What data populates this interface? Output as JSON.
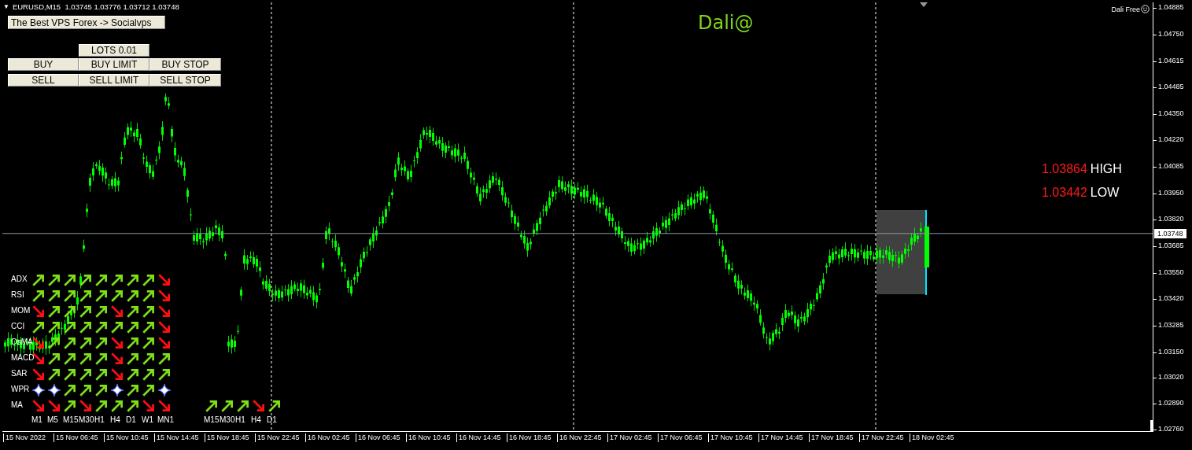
{
  "chart_header": {
    "collapse_glyph": "▼",
    "symbol_line": "EURUSD,M15  1.03745 1.03776 1.03712 1.03748"
  },
  "promo_button": "The Best VPS Forex -> Socialvps",
  "lots_button": "LOTS 0.01",
  "order_buttons": [
    {
      "labels": [
        "BUY",
        "BUY LIMIT",
        "BUY STOP"
      ]
    },
    {
      "labels": [
        "SELL",
        "SELL LIMIT",
        "SELL STOP"
      ]
    }
  ],
  "brand_label": "Dali@",
  "indicator_title": "Dali Free",
  "levels": [
    {
      "value": "1.03864",
      "label": "HIGH"
    },
    {
      "value": "1.03442",
      "label": "LOW"
    }
  ],
  "signal_matrix": {
    "rows": [
      {
        "name": "ADX",
        "signals": [
          {
            "kind": "up"
          },
          {
            "kind": "up"
          },
          {
            "kind": "up"
          },
          {
            "kind": "up"
          },
          {
            "kind": "up"
          },
          {
            "kind": "up"
          },
          {
            "kind": "up"
          },
          {
            "kind": "up"
          },
          {
            "kind": "down"
          }
        ]
      },
      {
        "name": "RSI",
        "signals": [
          {
            "kind": "up"
          },
          {
            "kind": "up"
          },
          {
            "kind": "up"
          },
          {
            "kind": "up"
          },
          {
            "kind": "up"
          },
          {
            "kind": "up"
          },
          {
            "kind": "up"
          },
          {
            "kind": "up"
          },
          {
            "kind": "down"
          }
        ]
      },
      {
        "name": "MOM",
        "signals": [
          {
            "kind": "down"
          },
          {
            "kind": "up"
          },
          {
            "kind": "up"
          },
          {
            "kind": "up"
          },
          {
            "kind": "up"
          },
          {
            "kind": "down"
          },
          {
            "kind": "up"
          },
          {
            "kind": "up"
          },
          {
            "kind": "down"
          }
        ]
      },
      {
        "name": "CCI",
        "signals": [
          {
            "kind": "up"
          },
          {
            "kind": "up"
          },
          {
            "kind": "up"
          },
          {
            "kind": "up"
          },
          {
            "kind": "up"
          },
          {
            "kind": "up"
          },
          {
            "kind": "up"
          },
          {
            "kind": "up"
          },
          {
            "kind": "down"
          }
        ]
      },
      {
        "name": "OsMA",
        "signals": [
          {
            "kind": "down"
          },
          {
            "kind": "up"
          },
          {
            "kind": "up"
          },
          {
            "kind": "up"
          },
          {
            "kind": "up"
          },
          {
            "kind": "down"
          },
          {
            "kind": "up"
          },
          {
            "kind": "up"
          },
          {
            "kind": "down"
          }
        ]
      },
      {
        "name": "MACD",
        "signals": [
          {
            "kind": "down"
          },
          {
            "kind": "up"
          },
          {
            "kind": "up"
          },
          {
            "kind": "up"
          },
          {
            "kind": "up"
          },
          {
            "kind": "down"
          },
          {
            "kind": "up"
          },
          {
            "kind": "up"
          },
          {
            "kind": "up"
          }
        ]
      },
      {
        "name": "SAR",
        "signals": [
          {
            "kind": "down"
          },
          {
            "kind": "up"
          },
          {
            "kind": "up"
          },
          {
            "kind": "up"
          },
          {
            "kind": "up"
          },
          {
            "kind": "down"
          },
          {
            "kind": "up"
          },
          {
            "kind": "up"
          },
          {
            "kind": "up"
          }
        ]
      },
      {
        "name": "WPR",
        "signals": [
          {
            "kind": "neutral"
          },
          {
            "kind": "neutral"
          },
          {
            "kind": "up"
          },
          {
            "kind": "up"
          },
          {
            "kind": "up"
          },
          {
            "kind": "neutral"
          },
          {
            "kind": "up"
          },
          {
            "kind": "up"
          },
          {
            "kind": "neutral"
          }
        ]
      },
      {
        "name": "MA",
        "signals": [
          {
            "kind": "down"
          },
          {
            "kind": "down"
          },
          {
            "kind": "up"
          },
          {
            "kind": "down"
          },
          {
            "kind": "up"
          },
          {
            "kind": "up"
          },
          {
            "kind": "up"
          },
          {
            "kind": "down"
          },
          {
            "kind": "down"
          }
        ]
      }
    ],
    "timeframes": [
      "M1",
      "M5",
      "M15",
      "M30",
      "H1",
      "H4",
      "D1",
      "W1",
      "MN1"
    ]
  },
  "second_matrix": {
    "signals": [
      {
        "kind": "up"
      },
      {
        "kind": "up"
      },
      {
        "kind": "up"
      },
      {
        "kind": "down"
      },
      {
        "kind": "up"
      }
    ],
    "timeframes": [
      "M15",
      "M30",
      "H1",
      "H4",
      "D1"
    ]
  },
  "price_axis": {
    "ticks": [
      {
        "label": "1.04885",
        "kind": "tick"
      },
      {
        "label": "1.04750",
        "kind": "tick"
      },
      {
        "label": "1.04615",
        "kind": "tick"
      },
      {
        "label": "1.04485",
        "kind": "tick"
      },
      {
        "label": "1.04350",
        "kind": "tick"
      },
      {
        "label": "1.04220",
        "kind": "tick"
      },
      {
        "label": "1.04085",
        "kind": "tick"
      },
      {
        "label": "1.03950",
        "kind": "tick"
      },
      {
        "label": "1.03820",
        "kind": "tick"
      },
      {
        "label": "1.03748",
        "kind": "current"
      },
      {
        "label": "1.03685",
        "kind": "tick"
      },
      {
        "label": "1.03550",
        "kind": "tick"
      },
      {
        "label": "1.03420",
        "kind": "tick"
      },
      {
        "label": "1.03285",
        "kind": "tick"
      },
      {
        "label": "1.03150",
        "kind": "tick"
      },
      {
        "label": "1.03020",
        "kind": "tick"
      },
      {
        "label": "1.02890",
        "kind": "tick"
      },
      {
        "label": "1.02760",
        "kind": "tick"
      }
    ]
  },
  "time_axis": {
    "labels": [
      "15 Nov 2022",
      "15 Nov 06:45",
      "15 Nov 10:45",
      "15 Nov 14:45",
      "15 Nov 18:45",
      "15 Nov 22:45",
      "16 Nov 02:45",
      "16 Nov 06:45",
      "16 Nov 10:45",
      "16 Nov 14:45",
      "16 Nov 18:45",
      "16 Nov 22:45",
      "17 Nov 02:45",
      "17 Nov 06:45",
      "17 Nov 10:45",
      "17 Nov 14:45",
      "17 Nov 18:45",
      "17 Nov 22:45",
      "18 Nov 02:45"
    ]
  }
}
